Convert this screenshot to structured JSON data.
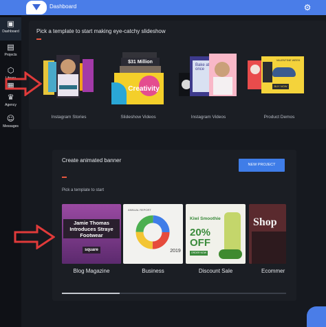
{
  "header": {
    "title": "Dashboard"
  },
  "sidebar": {
    "items": [
      {
        "label": "Dashboard",
        "icon": "dashboard-icon",
        "glyph": "▣"
      },
      {
        "label": "Projects",
        "icon": "film-icon",
        "glyph": "▤"
      },
      {
        "label": "Library",
        "icon": "cube-icon",
        "glyph": "⬡"
      },
      {
        "label": "",
        "icon": "film-strip-icon",
        "glyph": "▦"
      },
      {
        "label": "Agency",
        "icon": "crown-icon",
        "glyph": "♛"
      },
      {
        "label": "Messages",
        "icon": "robot-icon",
        "glyph": "☺"
      }
    ]
  },
  "slideshow": {
    "heading": "Pick a template to start making eye-catchy slideshow",
    "tiles": [
      {
        "label": "Instagram Stories"
      },
      {
        "label": "Slideshow Videos",
        "overlay_text": "$31 Million",
        "creativity_text": "Creativity"
      },
      {
        "label": "Instagram Videos",
        "overlay_text": "Bake at once"
      },
      {
        "label": "Product Demos",
        "overlay_text": "VALENTINE WEEK",
        "buy_text": "BUY NOW"
      }
    ]
  },
  "banner": {
    "heading": "Create animated banner",
    "new_project_label": "NEW PROJECT",
    "subheading": "Pick a template to start",
    "cards": [
      {
        "label": "Blog Magazine",
        "headline": "Jamie Thomas Introduces Straye Footwear",
        "tag": "square"
      },
      {
        "label": "Business",
        "caption": "ANNUAL REPORT",
        "year": "2019"
      },
      {
        "label": "Discount Sale",
        "product": "Kiwi Smoothie",
        "offer": "20% OFF",
        "pill": "ORDER NOW"
      },
      {
        "label": "Ecommer",
        "title": "Shop"
      }
    ]
  },
  "colors": {
    "accent_blue": "#4a7de8",
    "accent_red": "#e9573f",
    "arrow_red": "#e03a3a"
  }
}
